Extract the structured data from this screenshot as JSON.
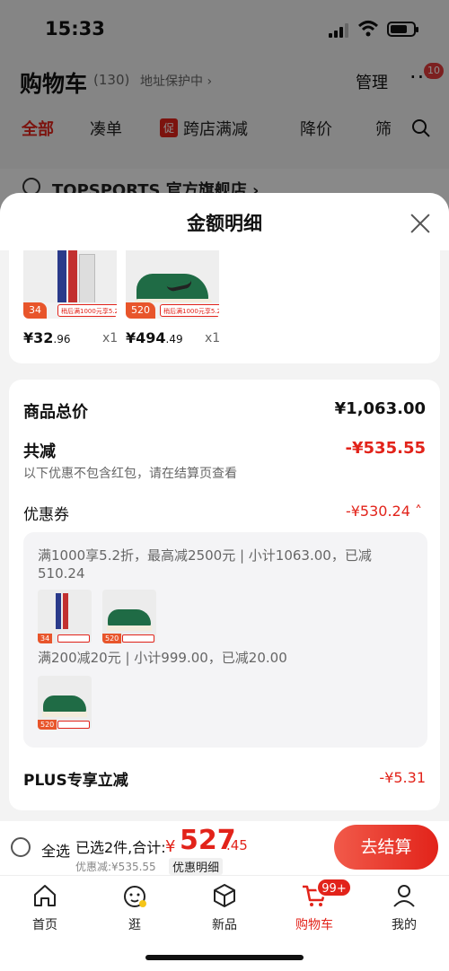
{
  "status": {
    "time": "15:33"
  },
  "cart_header": {
    "title": "购物车",
    "count": "(130)",
    "address_protect": "地址保护中 ›",
    "manage": "管理",
    "more": "···",
    "more_badge": "10"
  },
  "filter_tabs": {
    "all": "全部",
    "pair": "凑单",
    "promo_tag": "促",
    "cross_store": "跨店满减",
    "price_drop": "降价",
    "filter": "筛"
  },
  "store": {
    "name": "TOPSPORTS 官方旗舰店 ›"
  },
  "sheet": {
    "title": "金额明细",
    "products": [
      {
        "tag": "34",
        "label": "稍后满1000元享5.2折",
        "price_int": "¥32",
        "price_dec": ".96",
        "qty": "x1",
        "image": "socks-product-image"
      },
      {
        "tag": "520",
        "label": "稍后满1000元享5.2折",
        "price_int": "¥494",
        "price_dec": ".49",
        "qty": "x1",
        "image": "sneaker-product-image"
      }
    ],
    "total_label": "商品总价",
    "total_value": "¥1,063.00",
    "reduce_label": "共减",
    "reduce_value": "-¥535.55",
    "reduce_note": "以下优惠不包含红包，请在结算页查看",
    "coupon_label": "优惠券",
    "coupon_value": "-¥530.24 ˄",
    "coupon_line1": "满1000享5.2折，最高减2500元 | 小计1063.00，已减510.24",
    "coupon_line2": "满200减20元 | 小计999.00，已减20.00",
    "thumb_tags": [
      "34",
      "520",
      "520"
    ],
    "plus_label": "PLUS专享立减",
    "plus_value": "-¥5.31"
  },
  "checkout": {
    "select_all": "全选",
    "selected": "已选2件,合计:",
    "total_yen": "¥",
    "total_int": "527",
    "total_dec": ".45",
    "discount_summary": "优惠减:¥535.55",
    "detail_link": "优惠明细",
    "button": "去结算"
  },
  "tabbar": {
    "items": [
      {
        "label": "首页",
        "icon": "home-icon"
      },
      {
        "label": "逛",
        "icon": "browse-icon"
      },
      {
        "label": "新品",
        "icon": "new-products-icon"
      },
      {
        "label": "购物车",
        "icon": "cart-icon"
      },
      {
        "label": "我的",
        "icon": "profile-icon"
      }
    ],
    "cart_badge": "99+"
  },
  "colors": {
    "accent": "#e2231a",
    "promo_orange": "#e8552b",
    "sheet_bg": "#f3f3f3"
  }
}
